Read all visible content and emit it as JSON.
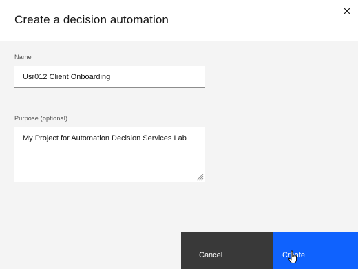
{
  "dialog": {
    "title": "Create a decision automation",
    "close_icon": "close-icon"
  },
  "form": {
    "name": {
      "label": "Name",
      "value": "Usr012 Client Onboarding"
    },
    "purpose": {
      "label": "Purpose (optional)",
      "value": "My Project for Automation Decision Services Lab"
    }
  },
  "footer": {
    "cancel_label": "Cancel",
    "create_label": "Create"
  },
  "colors": {
    "primary": "#0f62fe",
    "secondary": "#393939",
    "background": "#f4f4f4"
  }
}
